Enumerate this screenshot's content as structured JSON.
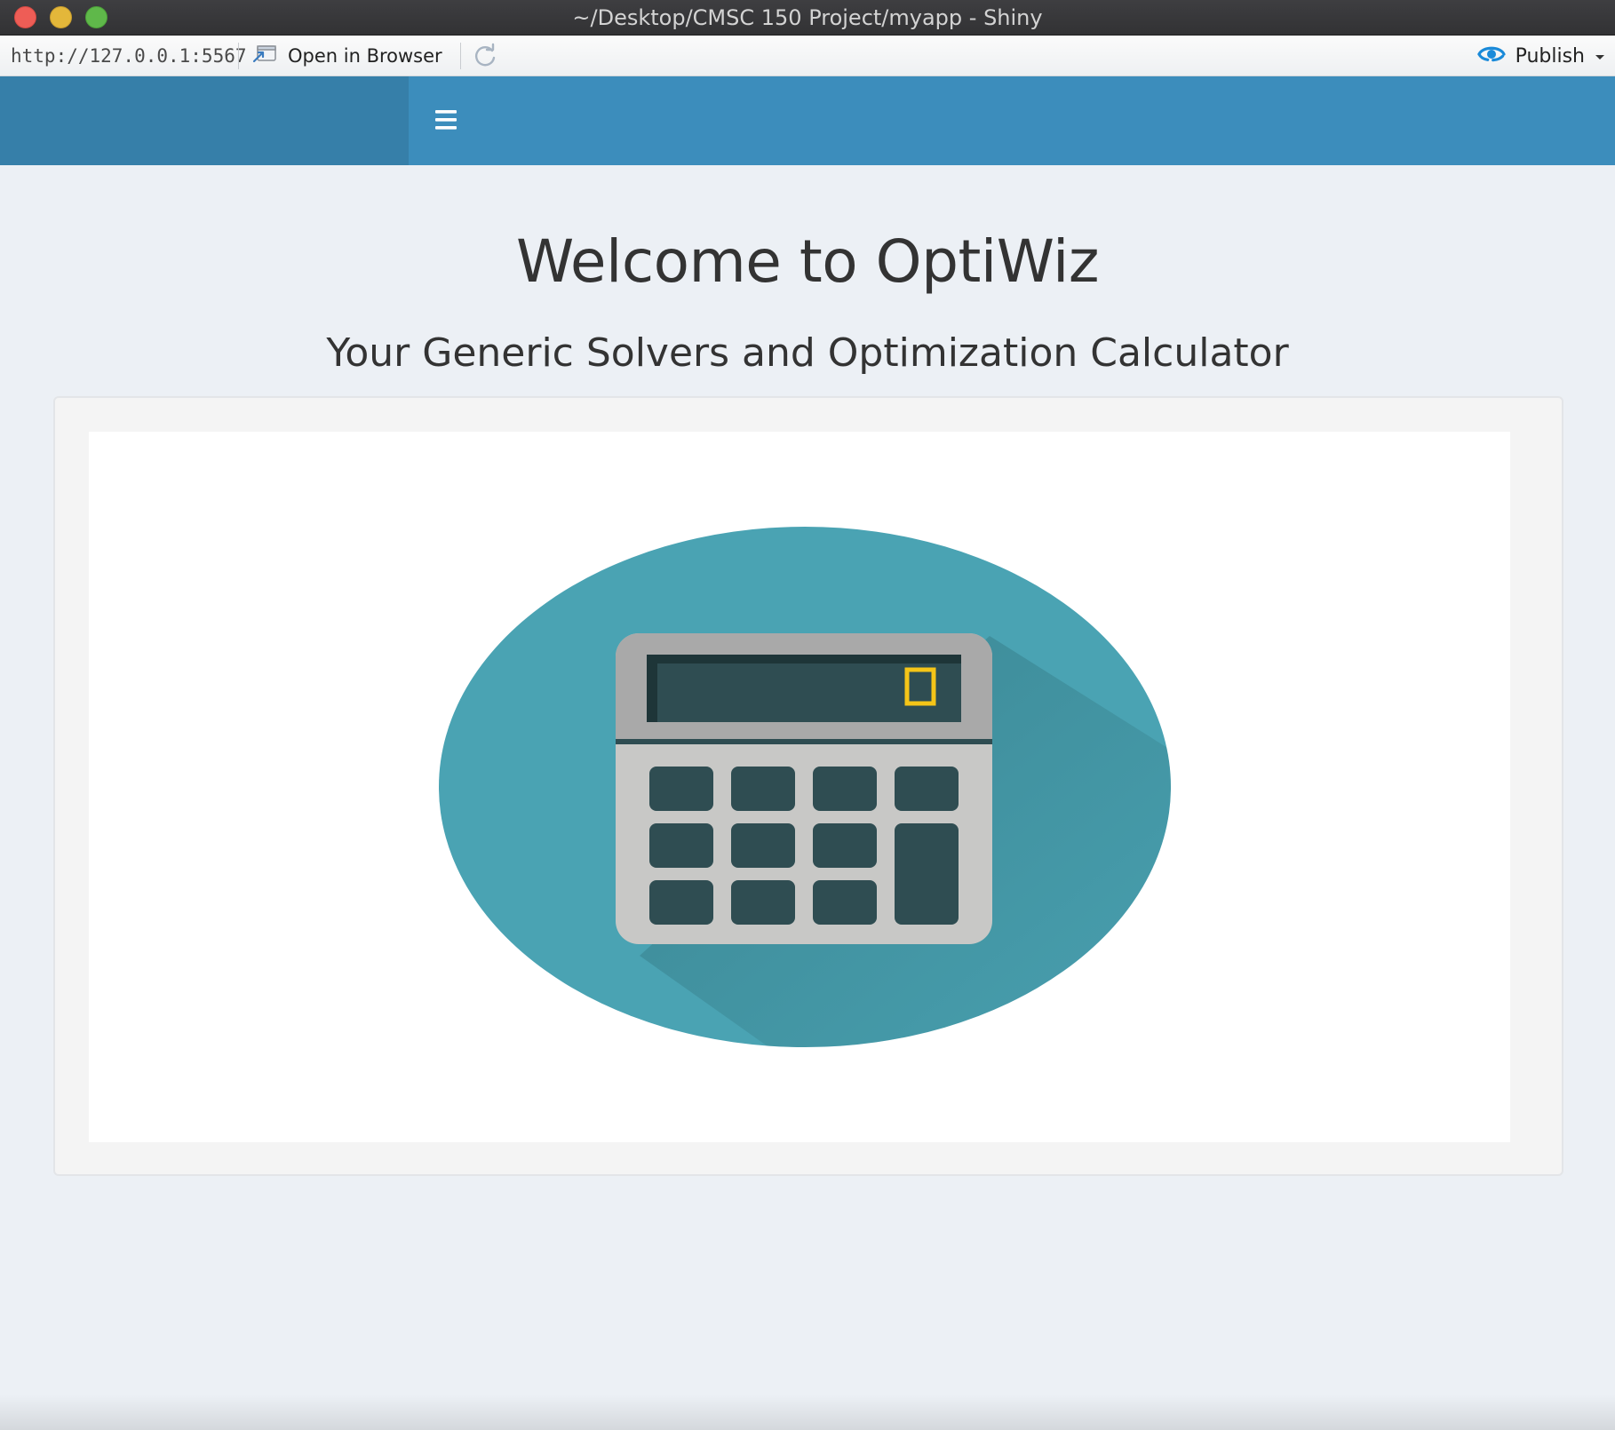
{
  "window": {
    "title": "~/Desktop/CMSC 150 Project/myapp - Shiny"
  },
  "toolbar": {
    "url": "http://127.0.0.1:5567",
    "open_in_browser_label": "Open in Browser",
    "publish_label": "Publish"
  },
  "header": {
    "toggle_icon": "hamburger-icon"
  },
  "main": {
    "title": "Welcome to OptiWiz",
    "subtitle": "Your Generic Solvers and Optimization Calculator",
    "image_icon": "calculator-icon"
  },
  "colors": {
    "header": "#3c8dbc",
    "logo_area": "#367fa9",
    "content_bg": "#ecf0f5",
    "calculator_circle": "#4aa3b3",
    "calculator_display": "#2f4d52",
    "calculator_indicator": "#f5c518"
  }
}
